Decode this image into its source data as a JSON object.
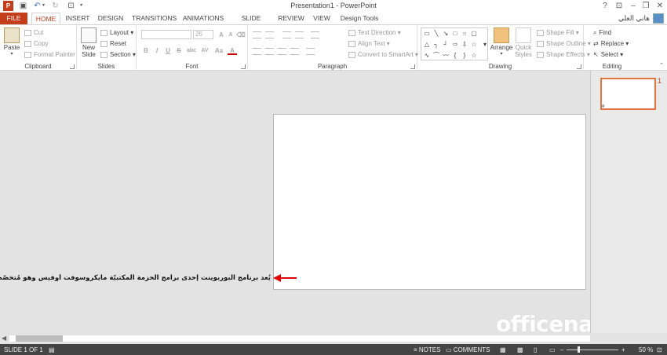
{
  "titlebar": {
    "title": "Presentation1 - PowerPoint"
  },
  "qat": [
    "powerpoint-icon",
    "save-icon",
    "undo-icon",
    "redo-icon",
    "start-slideshow-icon"
  ],
  "window": {
    "help": "?",
    "minimize": "–",
    "restore": "❐",
    "close": "✕"
  },
  "tabs": [
    "FILE",
    "HOME",
    "INSERT",
    "DESIGN",
    "TRANSITIONS",
    "ANIMATIONS",
    "SLIDE SHOW",
    "REVIEW",
    "VIEW",
    "Design Tools"
  ],
  "user": {
    "name": "هاني العلي"
  },
  "ribbon": {
    "clipboard": {
      "label": "Clipboard",
      "paste": "Paste",
      "cut": "Cut",
      "copy": "Copy",
      "format_painter": "Format Painter"
    },
    "slides": {
      "label": "Slides",
      "new_slide_1": "New",
      "new_slide_2": "Slide",
      "layout": "Layout",
      "reset": "Reset",
      "section": "Section"
    },
    "font": {
      "label": "Font",
      "size": "25",
      "bold": "B",
      "italic": "I",
      "underline": "U",
      "strike": "S",
      "shadow": "abc",
      "spacing": "AV",
      "case": "Aa",
      "color": "A"
    },
    "paragraph": {
      "label": "Paragraph",
      "text_direction": "Text Direction",
      "align_text": "Align Text",
      "convert_smartart": "Convert to SmartArt"
    },
    "drawing": {
      "label": "Drawing",
      "arrange": "Arrange",
      "quick_styles_1": "Quick",
      "quick_styles_2": "Styles",
      "shape_fill": "Shape Fill",
      "shape_outline": "Shape Outline",
      "shape_effects": "Shape Effects"
    },
    "editing": {
      "label": "Editing",
      "find": "Find",
      "replace": "Replace",
      "select": "Select"
    }
  },
  "workspace": {
    "annotation": "يُعد برنامج البوربوينت إحدى برامج الحزمة المكتبيّة مايكروسوفت أوفيس وهو مُتخصّص في إنشاء ال",
    "watermark": "officena.net"
  },
  "thumbs": {
    "number": "1"
  },
  "status": {
    "slide": "SLIDE 1 OF 1",
    "notes": "NOTES",
    "comments": "COMMENTS",
    "zoom": "50 %",
    "zoom_level": 0.5
  },
  "colors": {
    "accent": "#c43e1c",
    "status_bg": "#444444",
    "arrow": "#e00000"
  }
}
